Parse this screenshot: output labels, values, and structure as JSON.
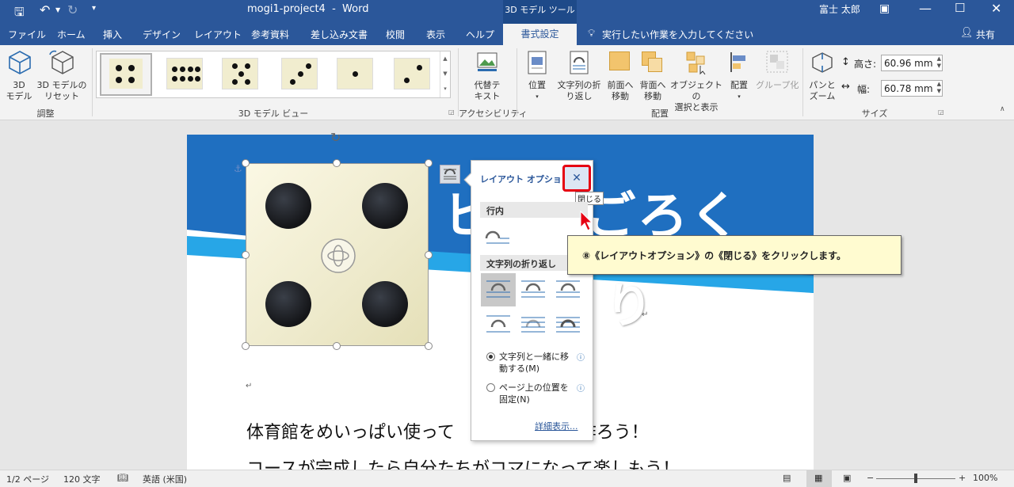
{
  "titlebar": {
    "doc_title": "mogi1-project4  -  Word",
    "context_tab": "3D モデル ツール",
    "user": "富士 太郎"
  },
  "tabs": {
    "items": [
      "ファイル",
      "ホーム",
      "挿入",
      "デザイン",
      "レイアウト",
      "参考資料",
      "差し込み文書",
      "校閲",
      "表示",
      "ヘルプ",
      "書式設定"
    ],
    "active": "書式設定",
    "tell_me": "実行したい作業を入力してください",
    "share": "共有"
  },
  "ribbon": {
    "adjust": {
      "model_3d": "3D\nモデル",
      "reset": "3D モデルの\nリセット",
      "group_label": "調整"
    },
    "view_group_label": "3D モデル ビュー",
    "accessibility": {
      "alt_text": "代替テ\nキスト",
      "group_label": "アクセシビリティ"
    },
    "arrange": {
      "position": "位置",
      "wrap_text": "文字列の折\nり返し",
      "bring_forward": "前面へ\n移動",
      "send_backward": "背面へ\n移動",
      "selection_pane": "オブジェクトの\n選択と表示",
      "align": "配置",
      "group": "グループ化",
      "group_label": "配置"
    },
    "size": {
      "pan_zoom": "パンと\nズーム",
      "height_label": "高さ:",
      "height_value": "60.96 mm",
      "width_label": "幅:",
      "width_value": "60.78 mm",
      "group_label": "サイズ"
    }
  },
  "document": {
    "banner_title": "ヒ  すごろく",
    "banner_sub": "り",
    "para1": "体育館をめいっぱい使って             ろくを作ろう！",
    "para2": "コースが完成したら自分たちがコマになって楽しもう！"
  },
  "layout_popup": {
    "title": "レイアウト オプション",
    "close_tooltip": "閉じる",
    "section_inline": "行内",
    "section_wrap": "文字列の折り返し",
    "option_move": "文字列と一緒に移\n動する(M)",
    "option_fixed": "ページ上の位置を\n固定(N)",
    "see_more": "詳細表示..."
  },
  "callout": {
    "text": "⑧《レイアウトオプション》の《閉じる》をクリックします。"
  },
  "statusbar": {
    "page": "1/2 ページ",
    "words": "120 文字",
    "language": "英語 (米国)",
    "zoom": "100%",
    "zoom_level": 1.0
  }
}
